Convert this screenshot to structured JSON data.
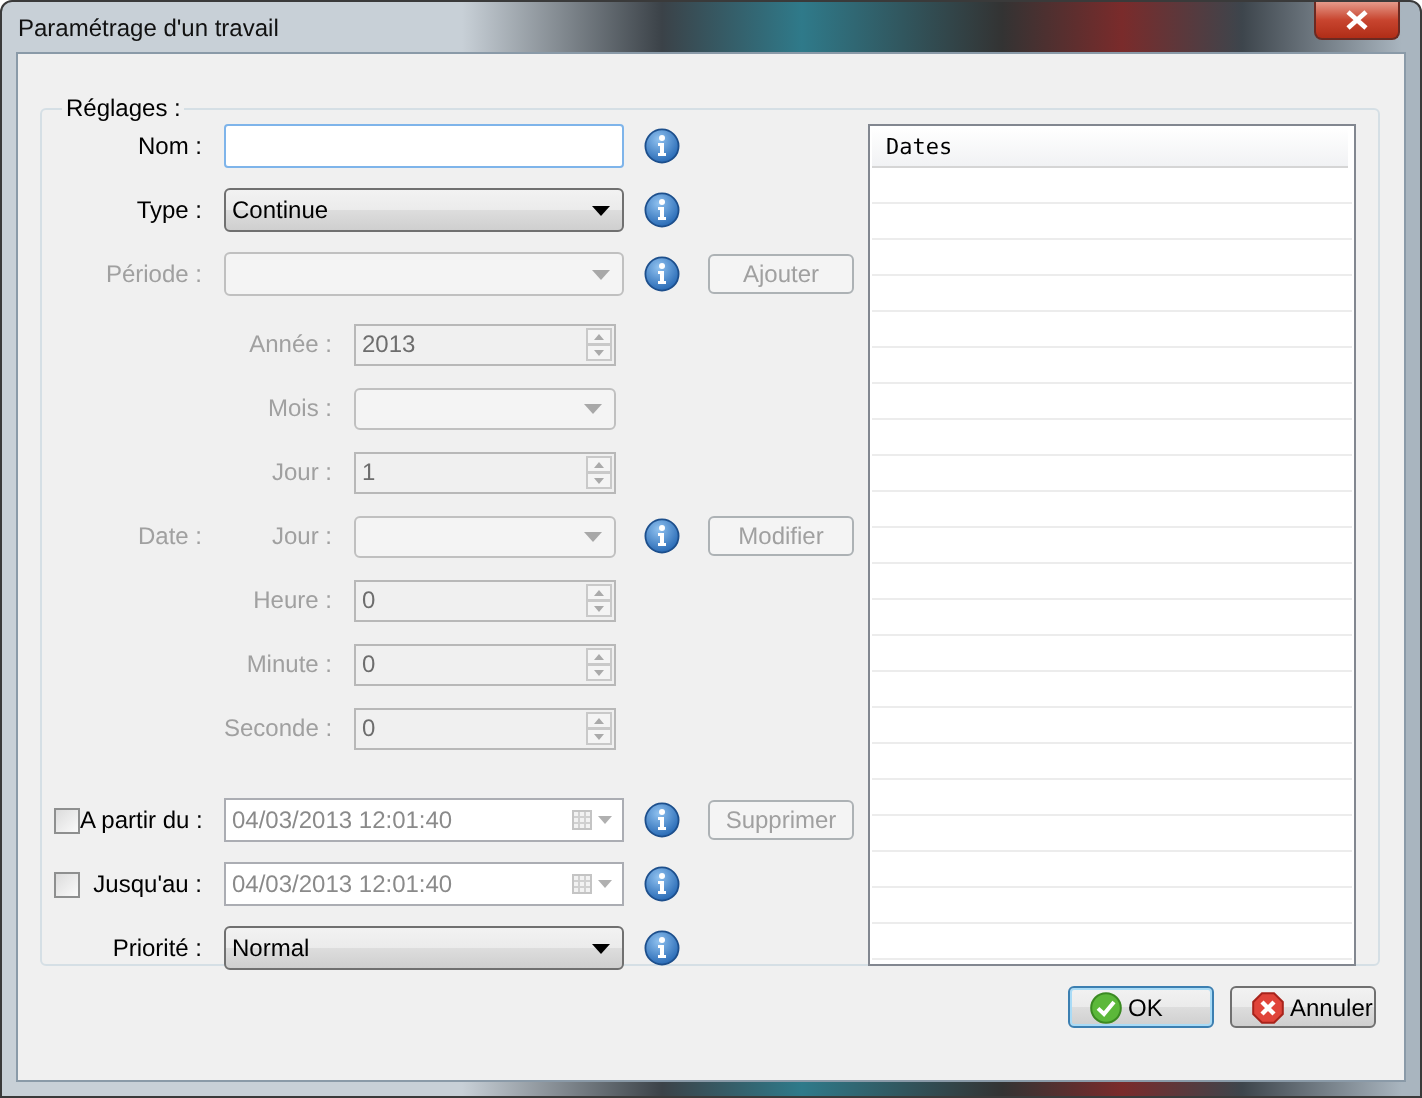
{
  "window": {
    "title": "Paramétrage d'un travail"
  },
  "group": {
    "label": "Réglages :"
  },
  "rows": [
    {
      "kind": "text",
      "label": "Nom :",
      "disabled": false,
      "info": true
    },
    {
      "kind": "combo",
      "label": "Type :",
      "value": "Continue",
      "disabled": false,
      "info": true
    },
    {
      "kind": "combo",
      "label": "Période :",
      "disabled": true,
      "info": true,
      "button": {
        "label": "Ajouter",
        "disabled": true
      }
    },
    {
      "kind": "spin",
      "sublabel": "Année :",
      "value": "2013",
      "disabled": true,
      "info": false
    },
    {
      "kind": "combo",
      "sublabel": "Mois :",
      "disabled": true,
      "info": false
    },
    {
      "kind": "spin",
      "sublabel": "Jour :",
      "value": "1",
      "disabled": true,
      "info": false
    },
    {
      "kind": "combo",
      "label": "Date :",
      "sublabel": "Jour :",
      "disabled": true,
      "info": true,
      "button": {
        "label": "Modifier",
        "disabled": true
      }
    },
    {
      "kind": "spin",
      "sublabel": "Heure :",
      "value": "0",
      "disabled": true,
      "info": false
    },
    {
      "kind": "spin",
      "sublabel": "Minute :",
      "value": "0",
      "disabled": true,
      "info": false
    },
    {
      "kind": "spin",
      "sublabel": "Seconde :",
      "value": "0",
      "disabled": true,
      "info": false
    },
    {
      "kind": "date",
      "label": "A partir du :",
      "checked": false,
      "value": "04/03/2013 12:01:40",
      "disabled": true,
      "info": true,
      "button": {
        "label": "Supprimer",
        "disabled": true
      }
    },
    {
      "kind": "date",
      "label": "Jusqu'au :",
      "checked": false,
      "value": "04/03/2013 12:01:40",
      "disabled": true,
      "info": true
    },
    {
      "kind": "combo",
      "label": "Priorité :",
      "value": "Normal",
      "disabled": false,
      "info": true
    }
  ],
  "list": {
    "column": "Dates"
  },
  "buttons": [
    {
      "label": "OK",
      "kind": "ok",
      "focused": true
    },
    {
      "label": "Annuler",
      "kind": "cancel",
      "focused": false
    }
  ]
}
